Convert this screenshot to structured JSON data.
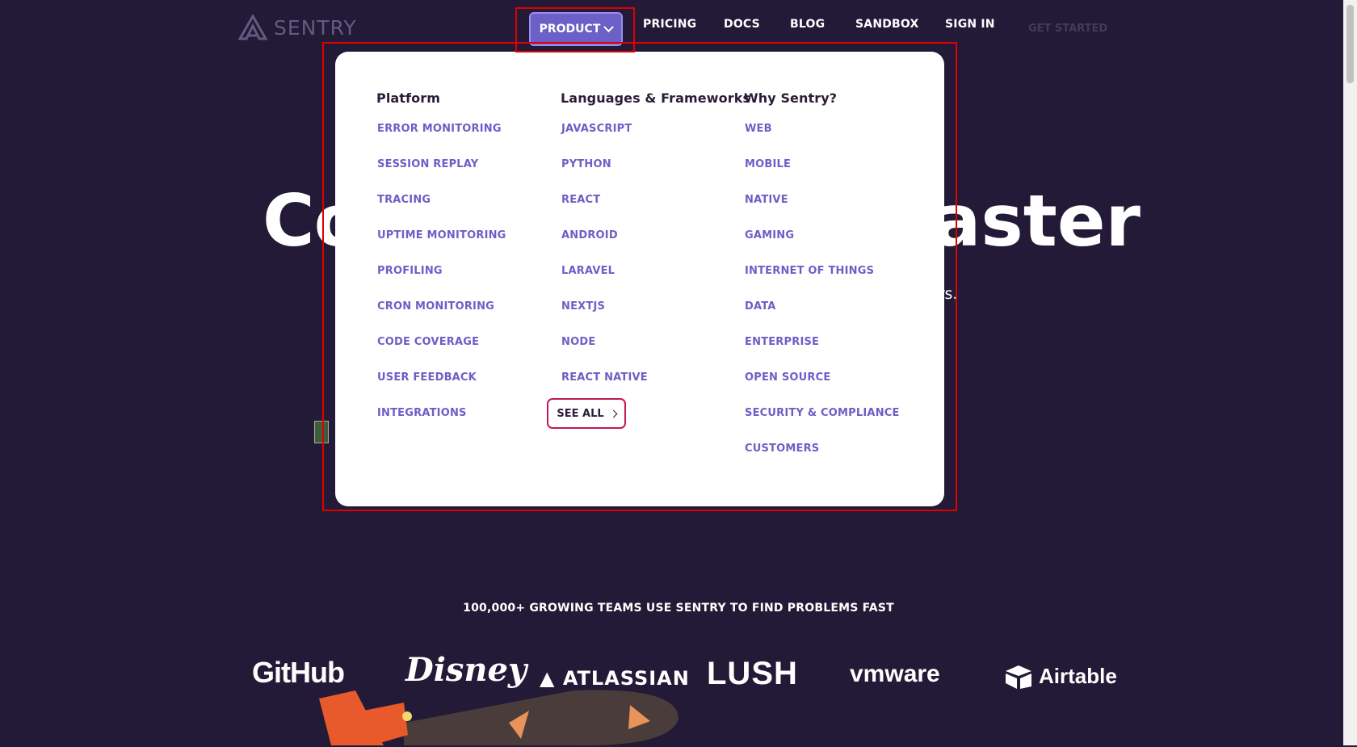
{
  "header": {
    "logo_text": "SENTRY",
    "nav": {
      "product": "PRODUCT",
      "pricing": "PRICING",
      "docs": "DOCS",
      "blog": "BLOG",
      "sandbox": "SANDBOX",
      "sign_in": "SIGN IN",
      "get_started": "GET STARTED"
    }
  },
  "hero": {
    "title_left": "Co",
    "title_right": "aster",
    "subtitle_right": "ers."
  },
  "dropdown": {
    "platform": {
      "heading": "Platform",
      "links": [
        "ERROR MONITORING",
        "SESSION REPLAY",
        "TRACING",
        "UPTIME MONITORING",
        "PROFILING",
        "CRON MONITORING",
        "CODE COVERAGE",
        "USER FEEDBACK",
        "INTEGRATIONS"
      ]
    },
    "languages": {
      "heading": "Languages & Frameworks",
      "links": [
        "JAVASCRIPT",
        "PYTHON",
        "REACT",
        "ANDROID",
        "LARAVEL",
        "NEXTJS",
        "NODE",
        "REACT NATIVE"
      ],
      "see_all": "SEE ALL"
    },
    "why": {
      "heading": "Why Sentry?",
      "links": [
        "WEB",
        "MOBILE",
        "NATIVE",
        "GAMING",
        "INTERNET OF THINGS",
        "DATA",
        "ENTERPRISE",
        "OPEN SOURCE",
        "SECURITY & COMPLIANCE",
        "CUSTOMERS"
      ]
    }
  },
  "teams": {
    "headline": "100,000+ GROWING TEAMS USE SENTRY TO FIND PROBLEMS FAST",
    "logos": [
      "GitHub",
      "Disney",
      "ATLASSIAN",
      "LUSH",
      "vmware",
      "Airtable"
    ]
  },
  "colors": {
    "background": "#221a36",
    "accent": "#6c5fc7",
    "link": "#6c5fc7",
    "highlight": "#e00000"
  }
}
